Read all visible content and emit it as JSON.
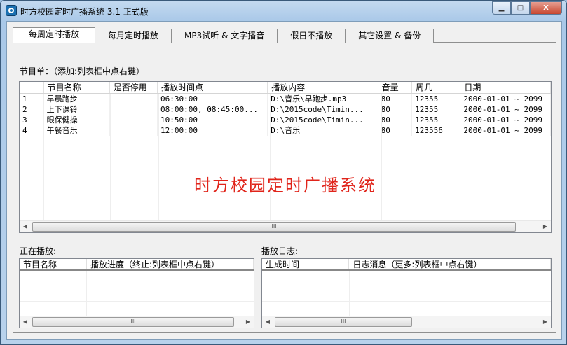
{
  "window": {
    "title": "时方校园定时广播系统 3.1 正式版",
    "min": "▁",
    "max": "□",
    "close": "X"
  },
  "tabs": [
    "每周定时播放",
    "每月定时播放",
    "MP3试听 & 文字播音",
    "假日不播放",
    "其它设置 & 备份"
  ],
  "program_list": {
    "label": "节目单：（添加:列表框中点右键）",
    "columns": [
      "",
      "节目名称",
      "是否停用",
      "播放时间点",
      "播放内容",
      "音量",
      "周几",
      "日期"
    ],
    "rows": [
      [
        "1",
        "早晨跑步",
        "",
        "06:30:00",
        "D:\\音乐\\早跑步.mp3",
        "80",
        "12355",
        "2000-01-01 ~ 2099"
      ],
      [
        "2",
        "上下课铃",
        "",
        "08:00:00, 08:45:00...",
        "D:\\2015code\\Timin...",
        "80",
        "12355",
        "2000-01-01 ~ 2099"
      ],
      [
        "3",
        "眼保健操",
        "",
        "10:50:00",
        "D:\\2015code\\Timin...",
        "80",
        "12355",
        "2000-01-01 ~ 2099"
      ],
      [
        "4",
        "午餐音乐",
        "",
        "12:00:00",
        "D:\\音乐",
        "80",
        "123556",
        "2000-01-01 ~ 2099"
      ]
    ],
    "watermark": "时方校园定时广播系统"
  },
  "now_playing": {
    "label": "正在播放:",
    "columns": [
      "节目名称",
      "播放进度（终止:列表框中点右键）"
    ]
  },
  "play_log": {
    "label": "播放日志:",
    "columns": [
      "生成时间",
      "日志消息（更多:列表框中点右键）"
    ]
  },
  "scroll": {
    "left": "◀",
    "right": "▶",
    "grip": "III"
  }
}
